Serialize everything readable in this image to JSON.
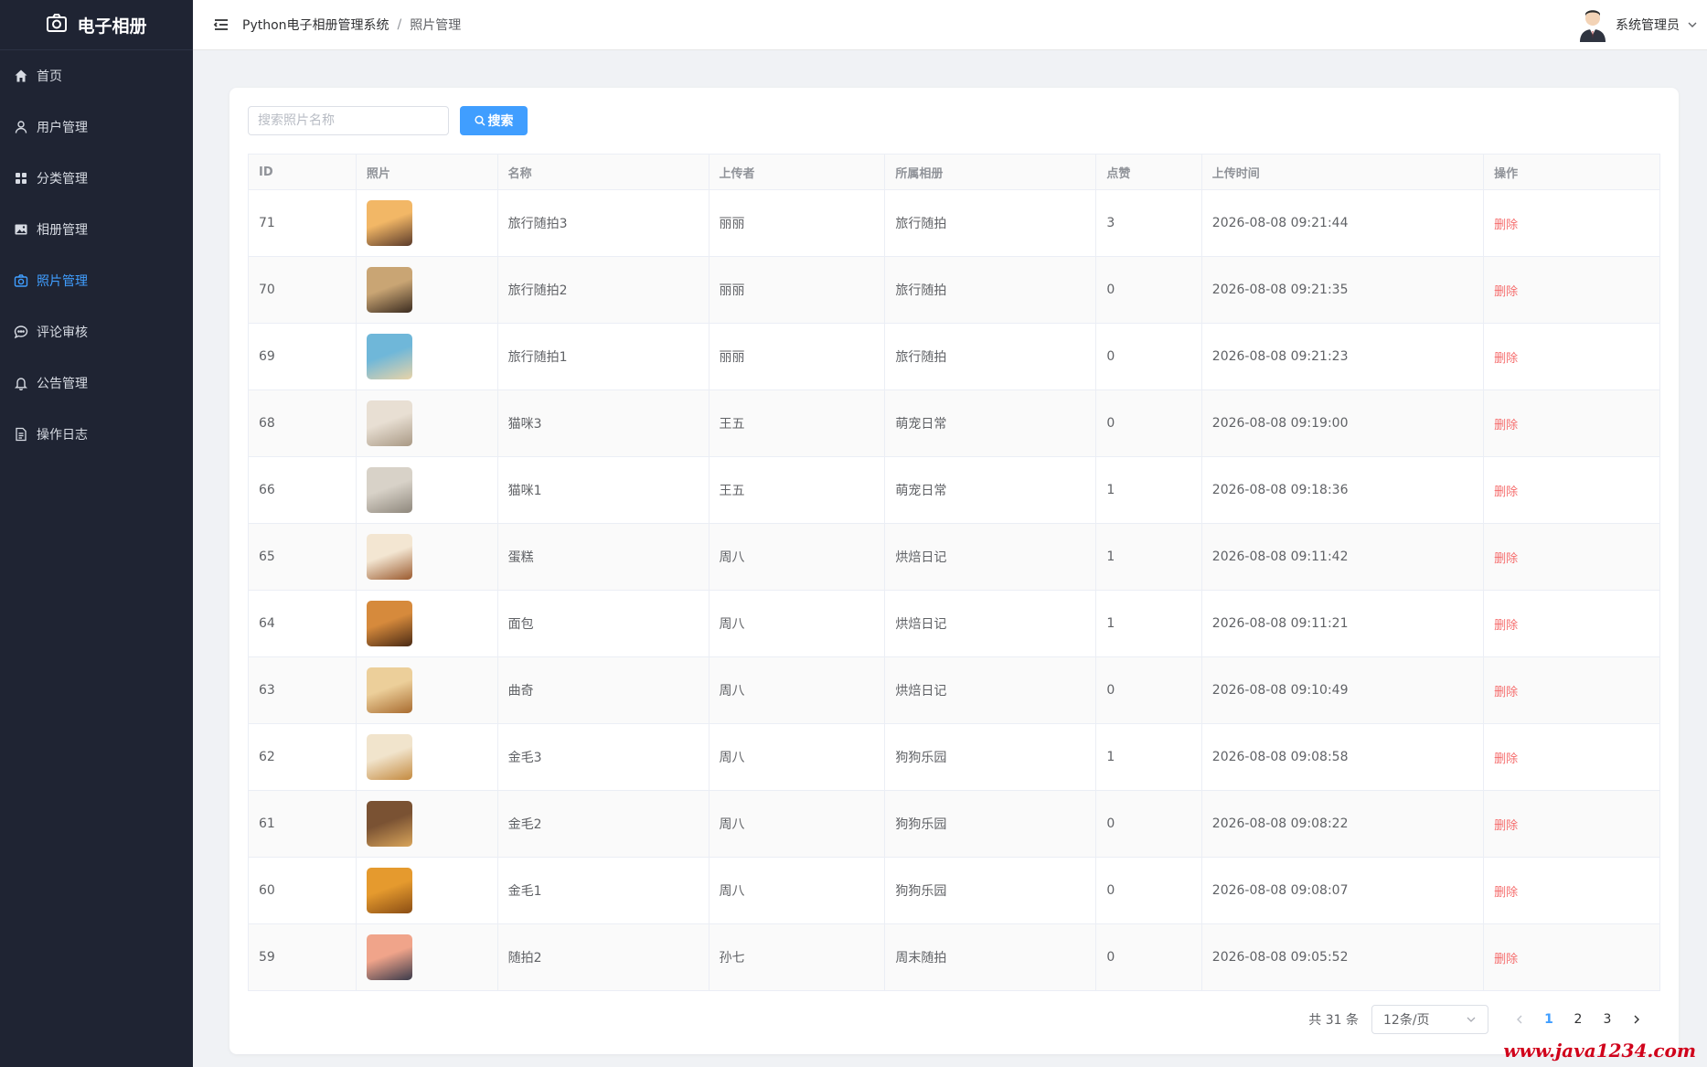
{
  "app": {
    "logo_text": "电子相册"
  },
  "sidebar": {
    "items": [
      {
        "label": "首页",
        "icon": "home-icon",
        "active": false
      },
      {
        "label": "用户管理",
        "icon": "user-icon",
        "active": false
      },
      {
        "label": "分类管理",
        "icon": "grid-icon",
        "active": false
      },
      {
        "label": "相册管理",
        "icon": "picture-icon",
        "active": false
      },
      {
        "label": "照片管理",
        "icon": "camera-icon",
        "active": true
      },
      {
        "label": "评论审核",
        "icon": "chat-icon",
        "active": false
      },
      {
        "label": "公告管理",
        "icon": "bell-icon",
        "active": false
      },
      {
        "label": "操作日志",
        "icon": "document-icon",
        "active": false
      }
    ]
  },
  "header": {
    "breadcrumb": [
      "Python电子相册管理系统",
      "照片管理"
    ],
    "breadcrumb_sep": "/",
    "user_name": "系统管理员"
  },
  "search": {
    "placeholder": "搜索照片名称",
    "button_label": "搜索"
  },
  "table": {
    "columns": [
      "ID",
      "照片",
      "名称",
      "上传者",
      "所属相册",
      "点赞",
      "上传时间",
      "操作"
    ],
    "rows": [
      {
        "id": "71",
        "name": "旅行随拍3",
        "uploader": "丽丽",
        "album": "旅行随拍",
        "likes": "3",
        "time": "2026-08-08 09:21:44",
        "action": "删除",
        "thumb": [
          "#f2b766",
          "#5a3a2a"
        ]
      },
      {
        "id": "70",
        "name": "旅行随拍2",
        "uploader": "丽丽",
        "album": "旅行随拍",
        "likes": "0",
        "time": "2026-08-08 09:21:35",
        "action": "删除",
        "thumb": [
          "#c9a574",
          "#3a2b1f"
        ]
      },
      {
        "id": "69",
        "name": "旅行随拍1",
        "uploader": "丽丽",
        "album": "旅行随拍",
        "likes": "0",
        "time": "2026-08-08 09:21:23",
        "action": "删除",
        "thumb": [
          "#6fb7d9",
          "#e9d4a8"
        ]
      },
      {
        "id": "68",
        "name": "猫咪3",
        "uploader": "王五",
        "album": "萌宠日常",
        "likes": "0",
        "time": "2026-08-08 09:19:00",
        "action": "删除",
        "thumb": [
          "#e8dfd3",
          "#a89884"
        ]
      },
      {
        "id": "66",
        "name": "猫咪1",
        "uploader": "王五",
        "album": "萌宠日常",
        "likes": "1",
        "time": "2026-08-08 09:18:36",
        "action": "删除",
        "thumb": [
          "#d8d2c8",
          "#8e877c"
        ]
      },
      {
        "id": "65",
        "name": "蛋糕",
        "uploader": "周八",
        "album": "烘焙日记",
        "likes": "1",
        "time": "2026-08-08 09:11:42",
        "action": "删除",
        "thumb": [
          "#f3e6d2",
          "#9b5a2e"
        ]
      },
      {
        "id": "64",
        "name": "面包",
        "uploader": "周八",
        "album": "烘焙日记",
        "likes": "1",
        "time": "2026-08-08 09:11:21",
        "action": "删除",
        "thumb": [
          "#d68a3c",
          "#4a2a14"
        ]
      },
      {
        "id": "63",
        "name": "曲奇",
        "uploader": "周八",
        "album": "烘焙日记",
        "likes": "0",
        "time": "2026-08-08 09:10:49",
        "action": "删除",
        "thumb": [
          "#eccf9a",
          "#a86b2f"
        ]
      },
      {
        "id": "62",
        "name": "金毛3",
        "uploader": "周八",
        "album": "狗狗乐园",
        "likes": "1",
        "time": "2026-08-08 09:08:58",
        "action": "删除",
        "thumb": [
          "#f1e4cc",
          "#c48a3f"
        ]
      },
      {
        "id": "61",
        "name": "金毛2",
        "uploader": "周八",
        "album": "狗狗乐园",
        "likes": "0",
        "time": "2026-08-08 09:08:22",
        "action": "删除",
        "thumb": [
          "#7a5233",
          "#d9a55a"
        ]
      },
      {
        "id": "60",
        "name": "金毛1",
        "uploader": "周八",
        "album": "狗狗乐园",
        "likes": "0",
        "time": "2026-08-08 09:08:07",
        "action": "删除",
        "thumb": [
          "#e59a2e",
          "#8a4d14"
        ]
      },
      {
        "id": "59",
        "name": "随拍2",
        "uploader": "孙七",
        "album": "周末随拍",
        "likes": "0",
        "time": "2026-08-08 09:05:52",
        "action": "删除",
        "thumb": [
          "#f0a48a",
          "#3a3a4a"
        ]
      }
    ]
  },
  "pagination": {
    "total_label": "共 31 条",
    "page_size_label": "12条/页",
    "pages": [
      "1",
      "2",
      "3"
    ],
    "current_page": "1"
  },
  "watermark": "www.java1234.com"
}
